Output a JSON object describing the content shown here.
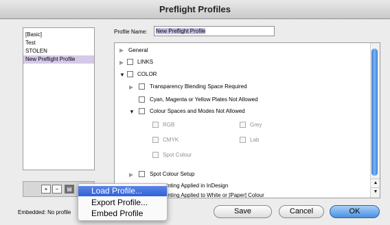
{
  "window": {
    "title": "Preflight Profiles"
  },
  "profiles": [
    {
      "label": "[Basic]",
      "selected": false
    },
    {
      "label": "Test",
      "selected": false
    },
    {
      "label": "STOLEN",
      "selected": false
    },
    {
      "label": "New Preflight Profile",
      "selected": true
    }
  ],
  "list_buttons": {
    "add": "+",
    "delete": "−",
    "menu": "▤"
  },
  "profile_name": {
    "label": "Profile Name:",
    "value": "New Preflight Profile"
  },
  "tree": {
    "general": "General",
    "links": "LINKS",
    "color": "COLOR",
    "transparency": "Transparency Blending Space Required",
    "cmy": "Cyan, Magenta or Yellow Plates Not Allowed",
    "color_spaces": "Colour Spaces and Modes Not Allowed",
    "rgb": "RGB",
    "grey": "Grey",
    "cmyk": "CMYK",
    "lab": "Lab",
    "spot": "Spot Colour",
    "spot_setup": "Spot Colour Setup",
    "overprint": "Overprinting Applied in InDesign",
    "overprint_white": "Overprinting Applied to White or [Paper] Colour"
  },
  "menu": {
    "load": "Load Profile...",
    "export": "Export Profile...",
    "embed": "Embed Profile"
  },
  "footer": {
    "embedded": "Embedded: No profile",
    "save": "Save",
    "cancel": "Cancel",
    "ok": "OK"
  }
}
